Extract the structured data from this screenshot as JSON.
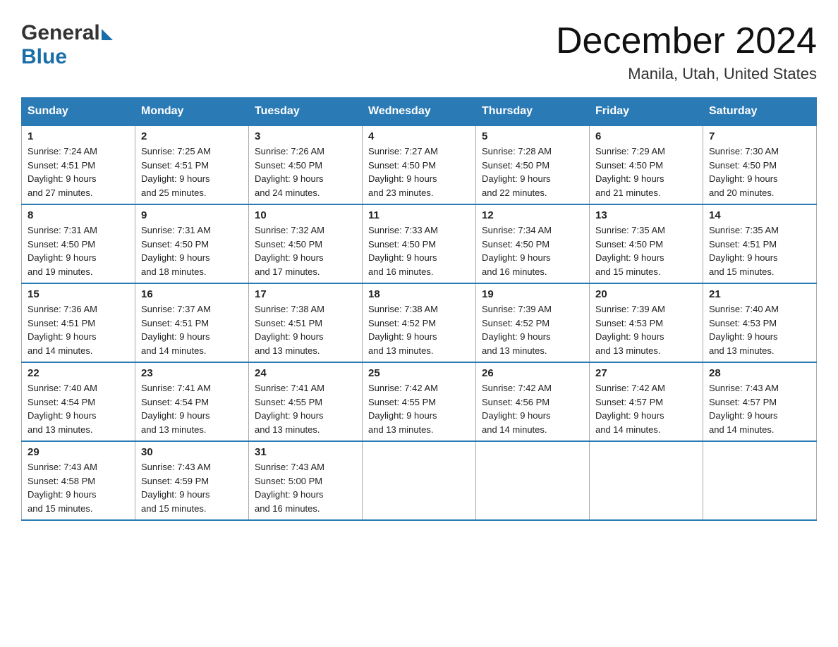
{
  "header": {
    "logo_general": "General",
    "logo_blue": "Blue",
    "month_title": "December 2024",
    "location": "Manila, Utah, United States"
  },
  "days_of_week": [
    "Sunday",
    "Monday",
    "Tuesday",
    "Wednesday",
    "Thursday",
    "Friday",
    "Saturday"
  ],
  "weeks": [
    [
      {
        "day": "1",
        "sunrise": "7:24 AM",
        "sunset": "4:51 PM",
        "daylight": "9 hours and 27 minutes."
      },
      {
        "day": "2",
        "sunrise": "7:25 AM",
        "sunset": "4:51 PM",
        "daylight": "9 hours and 25 minutes."
      },
      {
        "day": "3",
        "sunrise": "7:26 AM",
        "sunset": "4:50 PM",
        "daylight": "9 hours and 24 minutes."
      },
      {
        "day": "4",
        "sunrise": "7:27 AM",
        "sunset": "4:50 PM",
        "daylight": "9 hours and 23 minutes."
      },
      {
        "day": "5",
        "sunrise": "7:28 AM",
        "sunset": "4:50 PM",
        "daylight": "9 hours and 22 minutes."
      },
      {
        "day": "6",
        "sunrise": "7:29 AM",
        "sunset": "4:50 PM",
        "daylight": "9 hours and 21 minutes."
      },
      {
        "day": "7",
        "sunrise": "7:30 AM",
        "sunset": "4:50 PM",
        "daylight": "9 hours and 20 minutes."
      }
    ],
    [
      {
        "day": "8",
        "sunrise": "7:31 AM",
        "sunset": "4:50 PM",
        "daylight": "9 hours and 19 minutes."
      },
      {
        "day": "9",
        "sunrise": "7:31 AM",
        "sunset": "4:50 PM",
        "daylight": "9 hours and 18 minutes."
      },
      {
        "day": "10",
        "sunrise": "7:32 AM",
        "sunset": "4:50 PM",
        "daylight": "9 hours and 17 minutes."
      },
      {
        "day": "11",
        "sunrise": "7:33 AM",
        "sunset": "4:50 PM",
        "daylight": "9 hours and 16 minutes."
      },
      {
        "day": "12",
        "sunrise": "7:34 AM",
        "sunset": "4:50 PM",
        "daylight": "9 hours and 16 minutes."
      },
      {
        "day": "13",
        "sunrise": "7:35 AM",
        "sunset": "4:50 PM",
        "daylight": "9 hours and 15 minutes."
      },
      {
        "day": "14",
        "sunrise": "7:35 AM",
        "sunset": "4:51 PM",
        "daylight": "9 hours and 15 minutes."
      }
    ],
    [
      {
        "day": "15",
        "sunrise": "7:36 AM",
        "sunset": "4:51 PM",
        "daylight": "9 hours and 14 minutes."
      },
      {
        "day": "16",
        "sunrise": "7:37 AM",
        "sunset": "4:51 PM",
        "daylight": "9 hours and 14 minutes."
      },
      {
        "day": "17",
        "sunrise": "7:38 AM",
        "sunset": "4:51 PM",
        "daylight": "9 hours and 13 minutes."
      },
      {
        "day": "18",
        "sunrise": "7:38 AM",
        "sunset": "4:52 PM",
        "daylight": "9 hours and 13 minutes."
      },
      {
        "day": "19",
        "sunrise": "7:39 AM",
        "sunset": "4:52 PM",
        "daylight": "9 hours and 13 minutes."
      },
      {
        "day": "20",
        "sunrise": "7:39 AM",
        "sunset": "4:53 PM",
        "daylight": "9 hours and 13 minutes."
      },
      {
        "day": "21",
        "sunrise": "7:40 AM",
        "sunset": "4:53 PM",
        "daylight": "9 hours and 13 minutes."
      }
    ],
    [
      {
        "day": "22",
        "sunrise": "7:40 AM",
        "sunset": "4:54 PM",
        "daylight": "9 hours and 13 minutes."
      },
      {
        "day": "23",
        "sunrise": "7:41 AM",
        "sunset": "4:54 PM",
        "daylight": "9 hours and 13 minutes."
      },
      {
        "day": "24",
        "sunrise": "7:41 AM",
        "sunset": "4:55 PM",
        "daylight": "9 hours and 13 minutes."
      },
      {
        "day": "25",
        "sunrise": "7:42 AM",
        "sunset": "4:55 PM",
        "daylight": "9 hours and 13 minutes."
      },
      {
        "day": "26",
        "sunrise": "7:42 AM",
        "sunset": "4:56 PM",
        "daylight": "9 hours and 14 minutes."
      },
      {
        "day": "27",
        "sunrise": "7:42 AM",
        "sunset": "4:57 PM",
        "daylight": "9 hours and 14 minutes."
      },
      {
        "day": "28",
        "sunrise": "7:43 AM",
        "sunset": "4:57 PM",
        "daylight": "9 hours and 14 minutes."
      }
    ],
    [
      {
        "day": "29",
        "sunrise": "7:43 AM",
        "sunset": "4:58 PM",
        "daylight": "9 hours and 15 minutes."
      },
      {
        "day": "30",
        "sunrise": "7:43 AM",
        "sunset": "4:59 PM",
        "daylight": "9 hours and 15 minutes."
      },
      {
        "day": "31",
        "sunrise": "7:43 AM",
        "sunset": "5:00 PM",
        "daylight": "9 hours and 16 minutes."
      },
      null,
      null,
      null,
      null
    ]
  ],
  "labels": {
    "sunrise": "Sunrise:",
    "sunset": "Sunset:",
    "daylight": "Daylight:"
  }
}
